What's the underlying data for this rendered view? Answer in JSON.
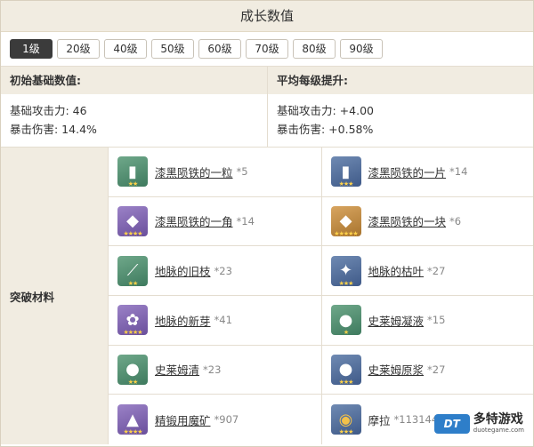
{
  "title": "成长数值",
  "levels": [
    "1级",
    "20级",
    "40级",
    "50级",
    "60级",
    "70级",
    "80级",
    "90级"
  ],
  "active_level": "1级",
  "base_stats": {
    "heading": "初始基础数值:",
    "atk": "基础攻击力: 46",
    "crit": "暴击伤害: 14.4%"
  },
  "growth_stats": {
    "heading": "平均每级提升:",
    "atk": "基础攻击力: +4.00",
    "crit": "暴击伤害: +0.58%"
  },
  "materials": {
    "label": "突破材料",
    "items": [
      {
        "name": "漆黑陨铁的一粒",
        "count": "*5",
        "rarity": 2,
        "icon": "fragment-icon"
      },
      {
        "name": "漆黑陨铁的一片",
        "count": "*14",
        "rarity": 3,
        "icon": "fragment-icon"
      },
      {
        "name": "漆黑陨铁的一角",
        "count": "*14",
        "rarity": 4,
        "icon": "chunk-icon"
      },
      {
        "name": "漆黑陨铁的一块",
        "count": "*6",
        "rarity": 5,
        "icon": "chunk-icon"
      },
      {
        "name": "地脉的旧枝",
        "count": "*23",
        "rarity": 2,
        "icon": "branch-icon"
      },
      {
        "name": "地脉的枯叶",
        "count": "*27",
        "rarity": 3,
        "icon": "leaf-icon"
      },
      {
        "name": "地脉的新芽",
        "count": "*41",
        "rarity": 4,
        "icon": "sprout-icon"
      },
      {
        "name": "史莱姆凝液",
        "count": "*15",
        "rarity": 1,
        "icon": "slime-icon"
      },
      {
        "name": "史莱姆清",
        "count": "*23",
        "rarity": 2,
        "icon": "slime-icon"
      },
      {
        "name": "史莱姆原浆",
        "count": "*27",
        "rarity": 3,
        "icon": "slime-icon"
      },
      {
        "name": "精锻用魔矿",
        "count": "*907",
        "rarity": 4,
        "icon": "crystal-icon"
      },
      {
        "name": "摩拉",
        "count": "*1131445",
        "rarity": 3,
        "icon": "coin-icon"
      }
    ]
  },
  "watermark": {
    "brand": "多特游戏",
    "url": "duotegame.com",
    "logo": "DT"
  }
}
